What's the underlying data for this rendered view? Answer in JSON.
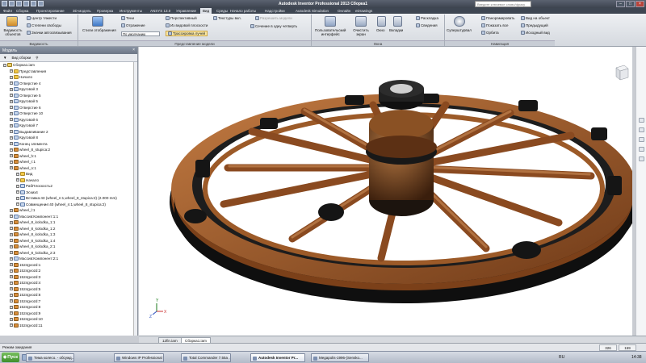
{
  "window": {
    "title": "Autodesk Inventor Professional 2013   Сборка1",
    "search_placeholder": "Введите ключевое слово/фразу"
  },
  "menu_tabs": [
    {
      "label": "Файл"
    },
    {
      "label": "Сборка"
    },
    {
      "label": "Проектирование"
    },
    {
      "label": "3D-модель"
    },
    {
      "label": "Проверка"
    },
    {
      "label": "Инструменты"
    },
    {
      "label": "ANSYS 13.0"
    },
    {
      "label": "Управление"
    },
    {
      "label": "Вид"
    },
    {
      "label": "Среды"
    },
    {
      "label": "Начало работы"
    },
    {
      "label": "Надстройки"
    },
    {
      "label": "Autodesk Simulation"
    },
    {
      "label": "Онлайн"
    },
    {
      "label": "eDrawings"
    }
  ],
  "ribbon": {
    "visibility_group": {
      "big_button": "Видимость объектов",
      "items": [
        "Центр тяжести",
        "Степени свободы",
        "Значки автосвязывания"
      ],
      "label": "Видимость"
    },
    "appearance_group": {
      "big_button": "Стили отображения",
      "items": [
        "Тени",
        "Отражение",
        "Перспективный",
        "Из видовой плоскости",
        "Трассировка лучей"
      ],
      "dropdown1": "Из по умолчанию",
      "dropdown2": "По умолчанию",
      "extra": [
        "Текстуры вкл.",
        "Разрешить модели"
      ],
      "section": "Сечение в одну четверть",
      "label": "Представление модели"
    },
    "window_group": {
      "buttons": [
        "Пользовательский интерфейс",
        "Очистить экран",
        "Окно",
        "Вкладки",
        "Раскладка",
        "Сведения"
      ],
      "label": "Окна"
    },
    "navigate_group": {
      "big_button": "Суперштурвал",
      "items": [
        "Панорамировать",
        "Показать все",
        "Орбита",
        "Вид на объект",
        "Предыдущий",
        "Исходный вид"
      ],
      "label": "Навигация"
    }
  },
  "browser": {
    "header": "Модель",
    "close": "×",
    "toolbar": {
      "filter": "Вид сборки",
      "find": "Найти"
    },
    "tree": [
      {
        "indent": 0,
        "icon": "asm",
        "label": "Сборка1.iam"
      },
      {
        "indent": 1,
        "icon": "fold",
        "label": "Представления"
      },
      {
        "indent": 1,
        "icon": "fold",
        "label": "Начало"
      },
      {
        "indent": 1,
        "icon": "feat",
        "label": "Отверстие 4"
      },
      {
        "indent": 1,
        "icon": "feat",
        "label": "Круговой 3"
      },
      {
        "indent": 1,
        "icon": "feat",
        "label": "Отверстие 5"
      },
      {
        "indent": 1,
        "icon": "feat",
        "label": "Круговой 5"
      },
      {
        "indent": 1,
        "icon": "feat",
        "label": "Отверстие 6"
      },
      {
        "indent": 1,
        "icon": "feat",
        "label": "Отверстие 10"
      },
      {
        "indent": 1,
        "icon": "feat",
        "label": "Круговой 6"
      },
      {
        "indent": 1,
        "icon": "feat",
        "label": "Круговой 7"
      },
      {
        "indent": 1,
        "icon": "feat",
        "label": "Выдавливание 2"
      },
      {
        "indent": 1,
        "icon": "feat",
        "label": "Круговой 8"
      },
      {
        "indent": 1,
        "icon": "feat",
        "label": "Конец элемента"
      },
      {
        "indent": 1,
        "icon": "part",
        "label": "wheel_8_stupica:2"
      },
      {
        "indent": 1,
        "icon": "part",
        "label": "wheel_h:1"
      },
      {
        "indent": 1,
        "icon": "part",
        "label": "wheel_r:1"
      },
      {
        "indent": 1,
        "icon": "part",
        "label": "wheel_n:1"
      },
      {
        "indent": 2,
        "icon": "fold",
        "label": "Вид"
      },
      {
        "indent": 2,
        "icon": "fold",
        "label": "Начало"
      },
      {
        "indent": 2,
        "icon": "feat",
        "label": "РабПлоскость2"
      },
      {
        "indent": 2,
        "icon": "feat",
        "label": "Эскиз4"
      },
      {
        "indent": 2,
        "icon": "feat",
        "label": "Вставка:43 (wheel_n:1,wheel_8_stupica:2) (2.000 mm)"
      },
      {
        "indent": 2,
        "icon": "feat",
        "label": "Совмещение:40 (wheel_n:1,wheel_8_stupica:2)"
      },
      {
        "indent": 1,
        "icon": "part",
        "label": "wheel_l:1"
      },
      {
        "indent": 1,
        "icon": "feat",
        "label": "Массив:Компонент:1:1"
      },
      {
        "indent": 1,
        "icon": "part",
        "label": "wheel_8_kolodka_1:1"
      },
      {
        "indent": 1,
        "icon": "part",
        "label": "wheel_8_kolodka_1:2"
      },
      {
        "indent": 1,
        "icon": "part",
        "label": "wheel_8_kolodka_1:3"
      },
      {
        "indent": 1,
        "icon": "part",
        "label": "wheel_8_kolodka_1:4"
      },
      {
        "indent": 1,
        "icon": "part",
        "label": "wheel_8_kolodka_2:1"
      },
      {
        "indent": 1,
        "icon": "part",
        "label": "wheel_8_kolodka_2:3"
      },
      {
        "indent": 1,
        "icon": "feat",
        "label": "Массив:Компонент:2:1"
      },
      {
        "indent": 1,
        "icon": "part",
        "label": "1524gvozd:1"
      },
      {
        "indent": 1,
        "icon": "part",
        "label": "1524gvozd:2"
      },
      {
        "indent": 1,
        "icon": "part",
        "label": "1524gvozd:3"
      },
      {
        "indent": 1,
        "icon": "part",
        "label": "1524gvozd:4"
      },
      {
        "indent": 1,
        "icon": "part",
        "label": "1524gvozd:5"
      },
      {
        "indent": 1,
        "icon": "part",
        "label": "1524gvozd:6"
      },
      {
        "indent": 1,
        "icon": "part",
        "label": "1524gvozd:7"
      },
      {
        "indent": 1,
        "icon": "part",
        "label": "1524gvozd:8"
      },
      {
        "indent": 1,
        "icon": "part",
        "label": "1524gvozd:9"
      },
      {
        "indent": 1,
        "icon": "part",
        "label": "1524gvozd:10"
      },
      {
        "indent": 1,
        "icon": "part",
        "label": "1524gvozd:11"
      }
    ]
  },
  "viewport": {
    "axis_labels": {
      "x": "X",
      "y": "Y",
      "z": "Z"
    },
    "model_colors": {
      "wood": "#8a4a20",
      "wood_light": "#b8733d",
      "iron": "#141414",
      "hub": "#3a2a1f"
    }
  },
  "doc_tabs": [
    {
      "label": "12fin.iam"
    },
    {
      "label": "Сборка1.iam"
    }
  ],
  "status": {
    "text": "Режим ожидания",
    "count1": "326",
    "count2": "159"
  },
  "taskbar": {
    "start": "Пуск",
    "tasks": [
      {
        "label": "Тема колесо. - обсужд..."
      },
      {
        "label": "Windows IP Professional ..."
      },
      {
        "label": "Total Commander 7.55a ..."
      },
      {
        "label": "Autodesk Inventor Pr..."
      },
      {
        "label": "Megapolis-1996-(Sensko..."
      }
    ],
    "lang": "RU",
    "clock": "14:38"
  }
}
